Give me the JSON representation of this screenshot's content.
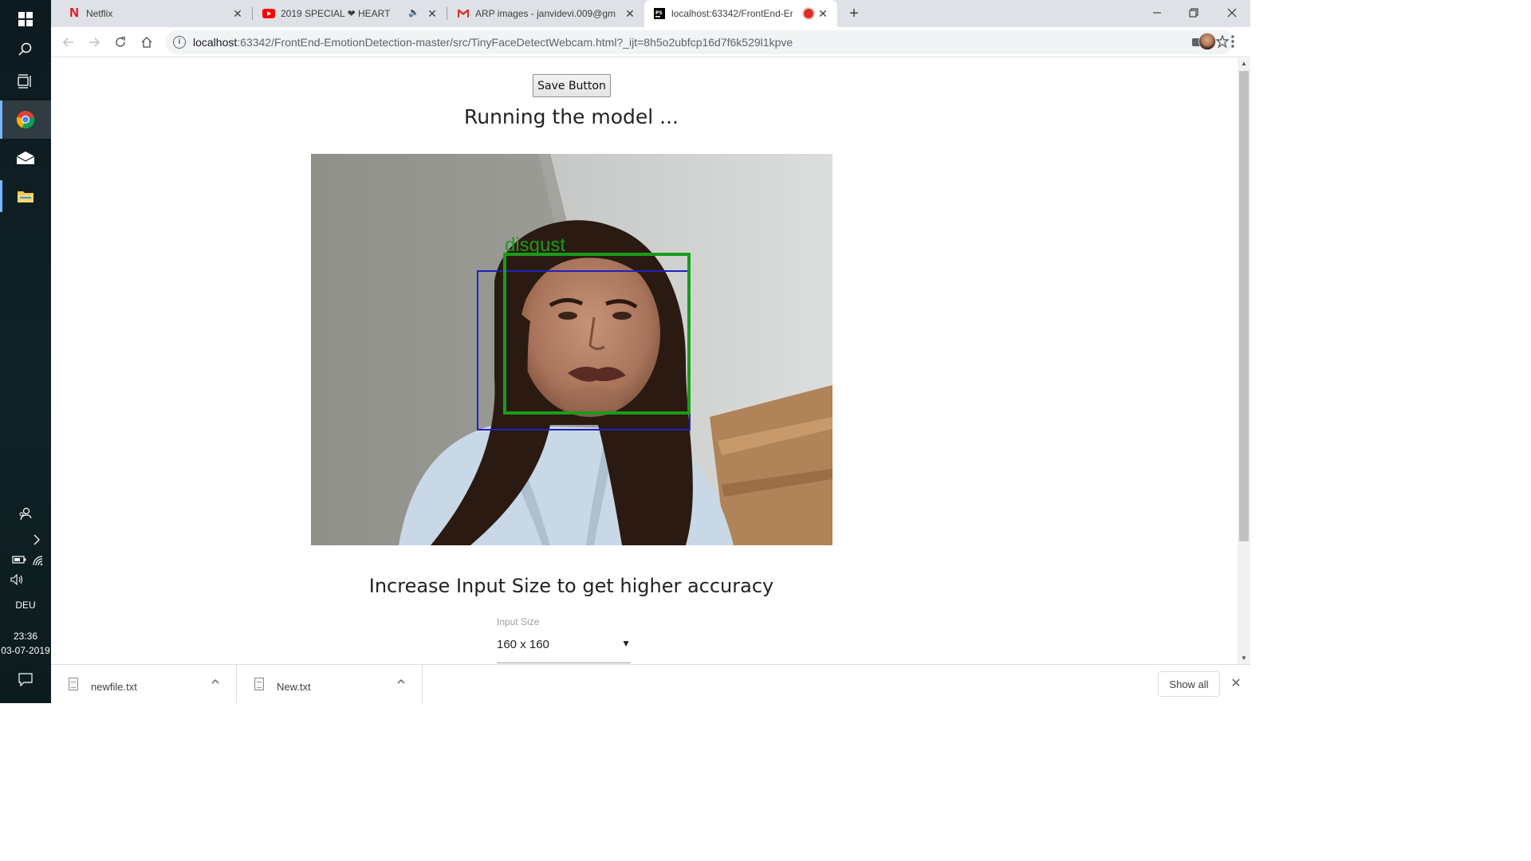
{
  "taskbar": {
    "language": "DEU",
    "time": "23:36",
    "date": "03-07-2019"
  },
  "browser": {
    "tabs": [
      {
        "title": "Netflix",
        "icon": "netflix-icon"
      },
      {
        "title": "2019 SPECIAL ❤ HEART",
        "icon": "youtube-icon"
      },
      {
        "title": "ARP images - janvidevi.009@gm",
        "icon": "gmail-icon"
      },
      {
        "title": "localhost:63342/FrontEnd-Er",
        "icon": "webstorm-icon"
      }
    ],
    "url_host": "localhost",
    "url_path": ":63342/FrontEnd-EmotionDetection-master/src/TinyFaceDetectWebcam.html?_ijt=8h5o2ubfcp16d7f6k529l1kpve"
  },
  "page": {
    "save_button": "Save Button",
    "status_heading": "Running the model ...",
    "accuracy_heading": "Increase Input Size to get higher accuracy",
    "input_size_label": "Input Size",
    "input_size_value": "160 x 160"
  },
  "detection": {
    "emotion_label": "disgust",
    "label_color": "#1a9c1a",
    "landmark_box_color": "#1a9c1a",
    "face_box_color": "#2020c0"
  },
  "downloads": {
    "items": [
      "newfile.txt",
      "New.txt"
    ],
    "show_all": "Show all"
  }
}
